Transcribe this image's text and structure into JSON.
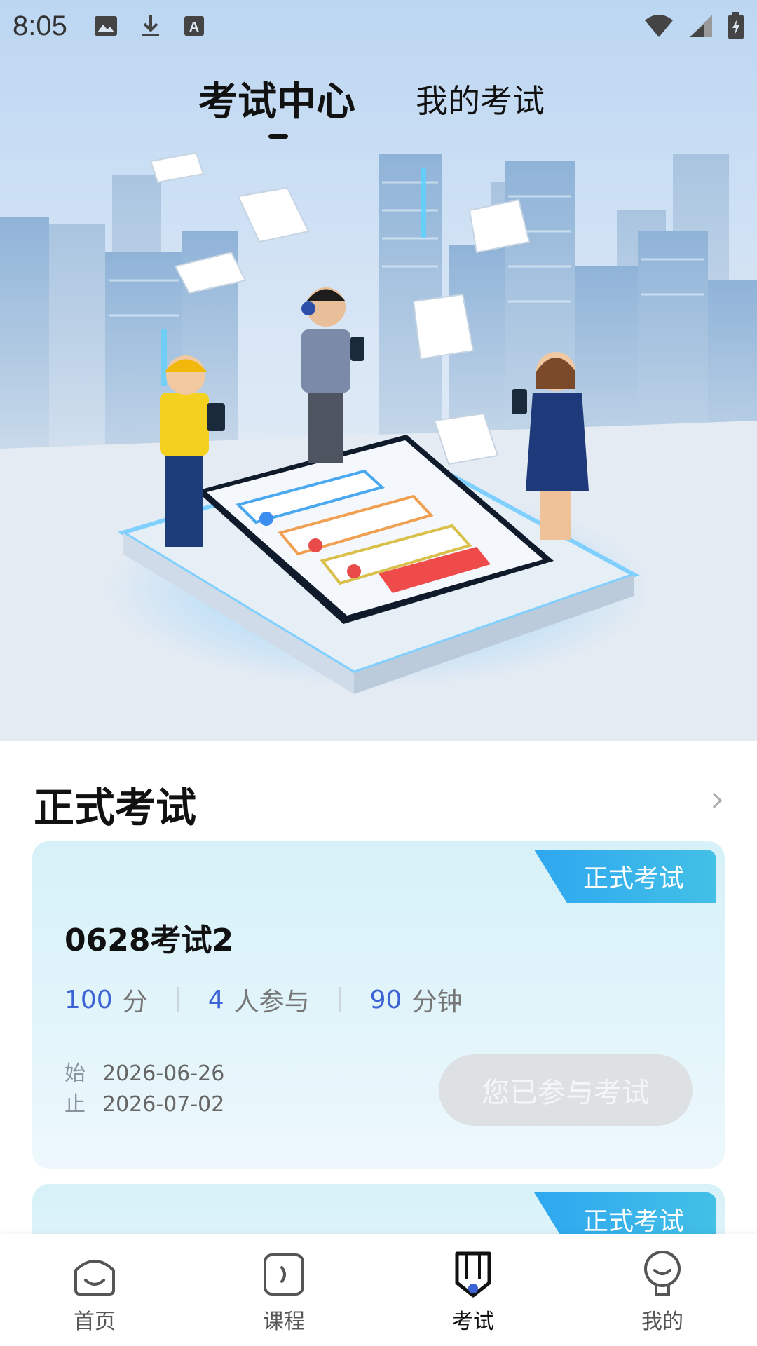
{
  "status_bar": {
    "time": "8:05",
    "left_icons": [
      "image-icon",
      "download-icon",
      "a-icon"
    ],
    "right_icons": [
      "wifi-icon",
      "signal-icon",
      "battery-icon"
    ]
  },
  "top_tabs": {
    "active": "考试中心",
    "inactive": "我的考试"
  },
  "section": {
    "title": "正式考试",
    "more_icon": "chevron-right-icon"
  },
  "exams": [
    {
      "tag": "正式考试",
      "name": "0628考试2",
      "score": "100",
      "score_unit": "分",
      "participants": "4",
      "participants_unit": "人参与",
      "duration": "90",
      "duration_unit": "分钟",
      "start_label": "始",
      "start_date": "2026-06-26",
      "end_label": "止",
      "end_date": "2026-07-02",
      "button": "您已参与考试"
    },
    {
      "tag": "正式考试"
    }
  ],
  "bottom_nav": [
    {
      "label": "首页",
      "icon": "home-icon"
    },
    {
      "label": "课程",
      "icon": "course-icon"
    },
    {
      "label": "考试",
      "icon": "exam-icon",
      "active": true
    },
    {
      "label": "我的",
      "icon": "profile-icon"
    }
  ],
  "colors": {
    "accent_blue": "#3b63d6",
    "tag_gradient_start": "#2ea7f0",
    "tag_gradient_end": "#43c0e6",
    "card_bg": "#d6f1f8",
    "active_nav_dot": "#3b63d6"
  }
}
